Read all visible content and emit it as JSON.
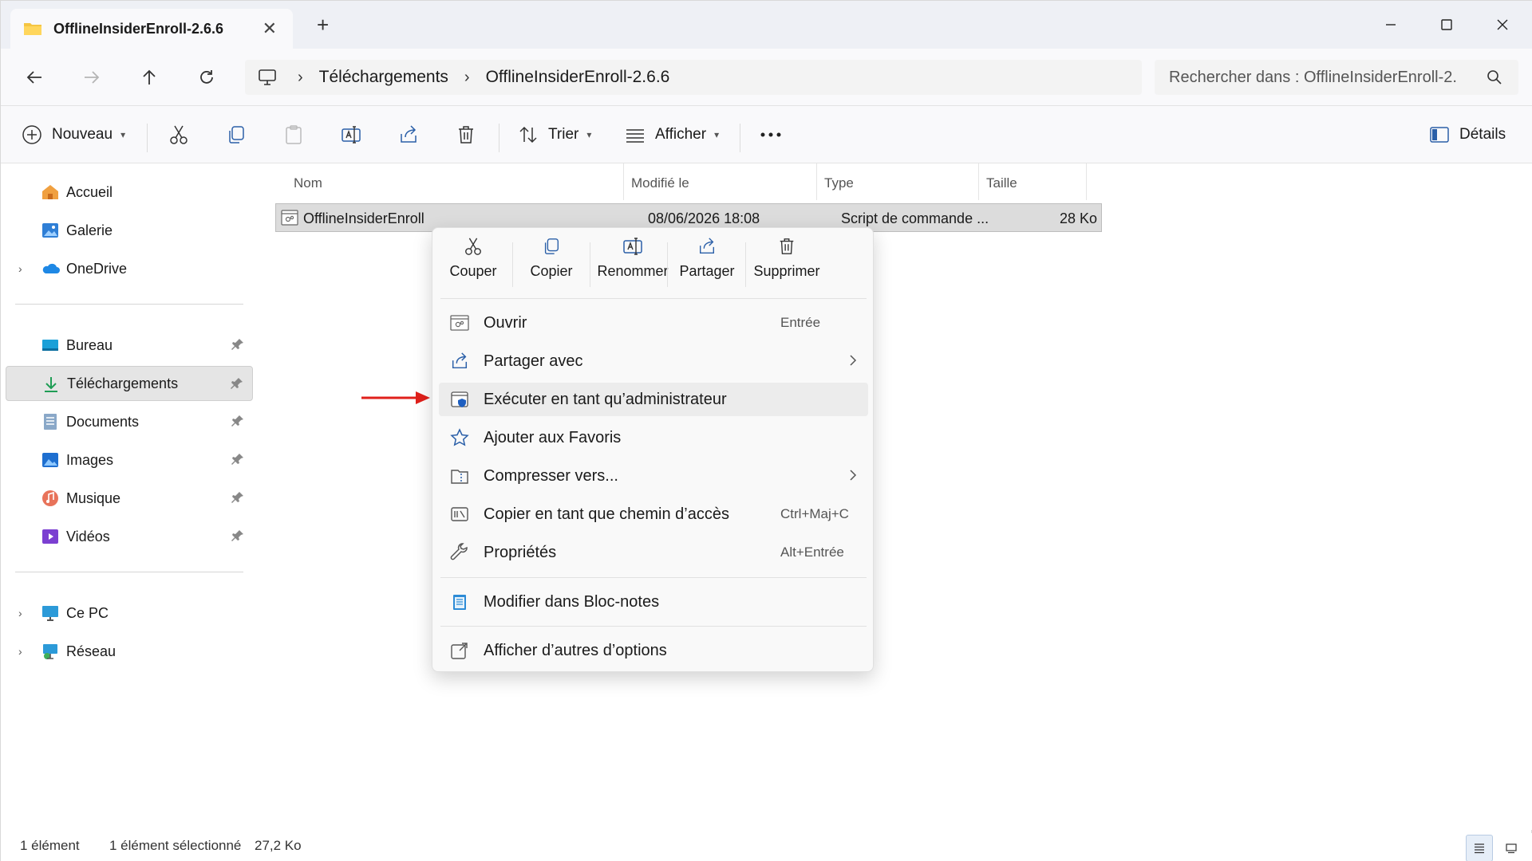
{
  "window": {
    "tab_title": "OfflineInsiderEnroll-2.6.6"
  },
  "address": {
    "crumbs": [
      "Téléchargements",
      "OfflineInsiderEnroll-2.6.6"
    ],
    "search_placeholder": "Rechercher dans : OfflineInsiderEnroll-2."
  },
  "toolbar": {
    "new_label": "Nouveau",
    "sort_label": "Trier",
    "view_label": "Afficher",
    "details_label": "Détails"
  },
  "sidebar": {
    "items": [
      {
        "label": "Accueil",
        "icon": "home-icon"
      },
      {
        "label": "Galerie",
        "icon": "gallery-icon"
      },
      {
        "label": "OneDrive",
        "icon": "onedrive-icon"
      },
      {
        "label": "Bureau",
        "icon": "desktop-folder-icon"
      },
      {
        "label": "Téléchargements",
        "icon": "downloads-folder-icon"
      },
      {
        "label": "Documents",
        "icon": "documents-folder-icon"
      },
      {
        "label": "Images",
        "icon": "pictures-folder-icon"
      },
      {
        "label": "Musique",
        "icon": "music-folder-icon"
      },
      {
        "label": "Vidéos",
        "icon": "videos-folder-icon"
      },
      {
        "label": "Ce PC",
        "icon": "this-pc-icon"
      },
      {
        "label": "Réseau",
        "icon": "network-icon"
      }
    ]
  },
  "filelist": {
    "columns": [
      "Nom",
      "Modifié le",
      "Type",
      "Taille"
    ],
    "rows": [
      {
        "name": "OfflineInsiderEnroll",
        "modified": "08/06/2026 18:08",
        "type": "Script de commande ...",
        "size": "28 Ko"
      }
    ]
  },
  "context_menu": {
    "quick_actions": [
      "Couper",
      "Copier",
      "Renommer",
      "Partager",
      "Supprimer"
    ],
    "items": [
      {
        "label": "Ouvrir",
        "shortcut": "Entrée"
      },
      {
        "label": "Partager avec",
        "shortcut": ""
      },
      {
        "label": "Exécuter en tant qu’administrateur",
        "shortcut": ""
      },
      {
        "label": "Ajouter aux Favoris",
        "shortcut": ""
      },
      {
        "label": "Compresser vers...",
        "shortcut": ""
      },
      {
        "label": "Copier en tant que chemin d’accès",
        "shortcut": "Ctrl+Maj+C"
      },
      {
        "label": "Propriétés",
        "shortcut": "Alt+Entrée"
      },
      {
        "label": "Modifier dans Bloc-notes",
        "shortcut": ""
      },
      {
        "label": "Afficher d’autres d’options",
        "shortcut": ""
      }
    ]
  },
  "status": {
    "count": "1 élément",
    "selection": "1 élément sélectionné",
    "size": "27,2 Ko"
  },
  "colors": {
    "accent": "#0067c0",
    "folder": "#f5c542",
    "arrow": "#e0201b"
  }
}
